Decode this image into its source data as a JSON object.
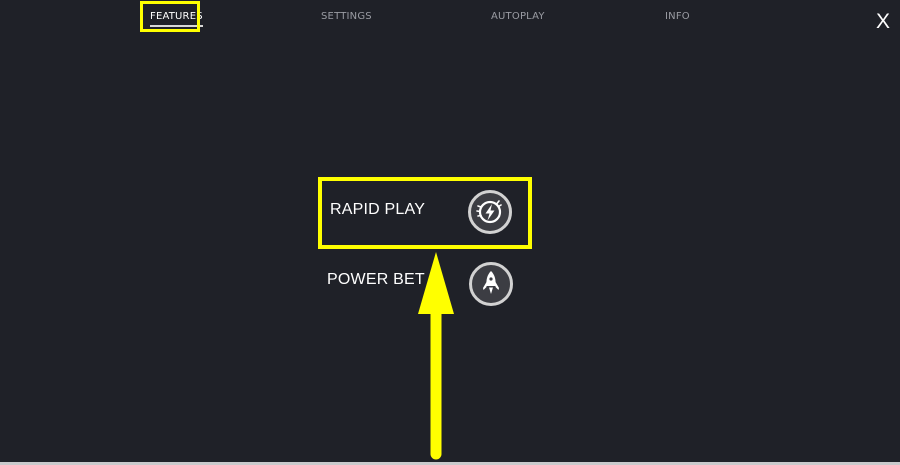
{
  "tabs": [
    {
      "label": "FEATURES",
      "active": true
    },
    {
      "label": "SETTINGS",
      "active": false
    },
    {
      "label": "AUTOPLAY",
      "active": false
    },
    {
      "label": "INFO",
      "active": false
    }
  ],
  "close_label": "X",
  "features": [
    {
      "label": "RAPID PLAY",
      "icon": "lightning-icon"
    },
    {
      "label": "POWER BET",
      "icon": "rocket-icon"
    }
  ],
  "colors": {
    "background": "#1f2128",
    "highlight": "#ffff00",
    "button_fill": "#3c3d43",
    "button_ring": "#d2d2d2",
    "tab_inactive": "#9a9ca3",
    "text": "#ffffff"
  }
}
